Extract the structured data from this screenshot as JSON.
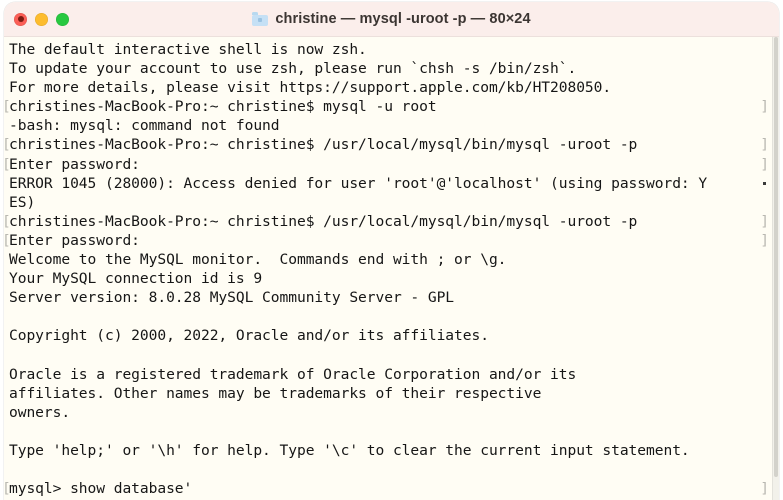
{
  "window": {
    "title": "christine — mysql -uroot -p — 80×24",
    "folder_icon": "folder-icon",
    "traffic_lights": [
      {
        "name": "close-button",
        "label": "Close",
        "color": "#fb5f57"
      },
      {
        "name": "minimize-button",
        "label": "Minimize",
        "color": "#fdbc2e"
      },
      {
        "name": "maximize-button",
        "label": "Maximize",
        "color": "#28c840"
      }
    ],
    "titlebar_bg": "#fbeeeb",
    "body_bg": "#fffdf4",
    "text_color": "#161616"
  },
  "terminal": {
    "cols": 80,
    "rows": 24,
    "prompt": "christines-MacBook-Pro:~ christine$ ",
    "mysql_prompt": "mysql> ",
    "lines": [
      {
        "text": "The default interactive shell is now zsh.",
        "mark_left": "",
        "mark_right": "",
        "wrap_dot": false
      },
      {
        "text": "To update your account to use zsh, please run `chsh -s /bin/zsh`.",
        "mark_left": "",
        "mark_right": "",
        "wrap_dot": false
      },
      {
        "text": "For more details, please visit https://support.apple.com/kb/HT208050.",
        "mark_left": "",
        "mark_right": "",
        "wrap_dot": false
      },
      {
        "text": "christines-MacBook-Pro:~ christine$ mysql -u root",
        "mark_left": "[",
        "mark_right": "]",
        "wrap_dot": false
      },
      {
        "text": "-bash: mysql: command not found",
        "mark_left": "",
        "mark_right": "",
        "wrap_dot": false
      },
      {
        "text": "christines-MacBook-Pro:~ christine$ /usr/local/mysql/bin/mysql -uroot -p",
        "mark_left": "[",
        "mark_right": "]",
        "wrap_dot": false
      },
      {
        "text": "Enter password:",
        "mark_left": "[",
        "mark_right": "]",
        "wrap_dot": false
      },
      {
        "text": "ERROR 1045 (28000): Access denied for user 'root'@'localhost' (using password: Y",
        "mark_left": "",
        "mark_right": "",
        "wrap_dot": true
      },
      {
        "text": "ES)",
        "mark_left": "",
        "mark_right": "",
        "wrap_dot": false
      },
      {
        "text": "christines-MacBook-Pro:~ christine$ /usr/local/mysql/bin/mysql -uroot -p",
        "mark_left": "[",
        "mark_right": "]",
        "wrap_dot": false
      },
      {
        "text": "Enter password:",
        "mark_left": "[",
        "mark_right": "]",
        "wrap_dot": false
      },
      {
        "text": "Welcome to the MySQL monitor.  Commands end with ; or \\g.",
        "mark_left": "",
        "mark_right": "",
        "wrap_dot": false
      },
      {
        "text": "Your MySQL connection id is 9",
        "mark_left": "",
        "mark_right": "",
        "wrap_dot": false
      },
      {
        "text": "Server version: 8.0.28 MySQL Community Server - GPL",
        "mark_left": "",
        "mark_right": "",
        "wrap_dot": false
      },
      {
        "text": "",
        "mark_left": "",
        "mark_right": "",
        "wrap_dot": false
      },
      {
        "text": "Copyright (c) 2000, 2022, Oracle and/or its affiliates.",
        "mark_left": "",
        "mark_right": "",
        "wrap_dot": false
      },
      {
        "text": "",
        "mark_left": "",
        "mark_right": "",
        "wrap_dot": false
      },
      {
        "text": "Oracle is a registered trademark of Oracle Corporation and/or its",
        "mark_left": "",
        "mark_right": "",
        "wrap_dot": false
      },
      {
        "text": "affiliates. Other names may be trademarks of their respective",
        "mark_left": "",
        "mark_right": "",
        "wrap_dot": false
      },
      {
        "text": "owners.",
        "mark_left": "",
        "mark_right": "",
        "wrap_dot": false
      },
      {
        "text": "",
        "mark_left": "",
        "mark_right": "",
        "wrap_dot": false
      },
      {
        "text": "Type 'help;' or '\\h' for help. Type '\\c' to clear the current input statement.",
        "mark_left": "",
        "mark_right": "",
        "wrap_dot": false
      },
      {
        "text": "",
        "mark_left": "",
        "mark_right": "",
        "wrap_dot": false
      },
      {
        "text": "mysql> show database'",
        "mark_left": "[",
        "mark_right": "]",
        "wrap_dot": false
      }
    ]
  }
}
